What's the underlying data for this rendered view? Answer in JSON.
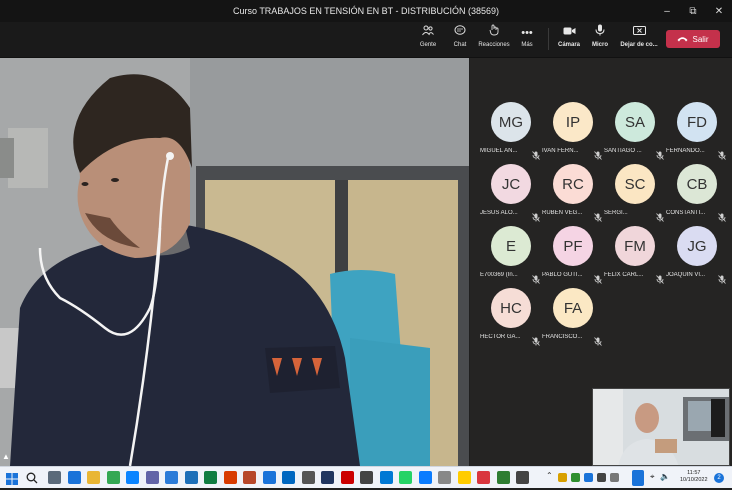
{
  "window": {
    "title": "Curso TRABAJOS EN TENSIÓN EN BT - DISTRIBUCIÓN (38569)",
    "minimize_icon": "minimize-icon",
    "restore_icon": "restore-icon",
    "close_icon": "close-icon"
  },
  "toolbar": {
    "people_label": "Gente",
    "chat_label": "Chat",
    "reactions_label": "Reacciones",
    "more_label": "Más",
    "camera_label": "Cámara",
    "mic_label": "Micro",
    "share_label": "Dejar de co...",
    "leave_label": "Salir",
    "leave_color": "#c4314b"
  },
  "participants": [
    {
      "initials": "MG",
      "name": "MIGUEL AN...",
      "color": "#dce4ea"
    },
    {
      "initials": "IP",
      "name": "IVAN FERN...",
      "color": "#fbe8c8"
    },
    {
      "initials": "SA",
      "name": "SANTIAGO ...",
      "color": "#cde9dc"
    },
    {
      "initials": "FD",
      "name": "FERNANDO...",
      "color": "#d2e3f2"
    },
    {
      "initials": "JC",
      "name": "JESUS ALO...",
      "color": "#f2d9e1"
    },
    {
      "initials": "RC",
      "name": "RUBEN VEG...",
      "color": "#fbdcd5"
    },
    {
      "initials": "SC",
      "name": "SERGI...",
      "color": "#fbe6c3"
    },
    {
      "initials": "CB",
      "name": "CONSTANTI...",
      "color": "#dce7d6"
    },
    {
      "initials": "E",
      "name": "E700369 (In...",
      "color": "#dcead3"
    },
    {
      "initials": "PF",
      "name": "PABLO GUTI...",
      "color": "#f5d4e4"
    },
    {
      "initials": "FM",
      "name": "FELIX CARL...",
      "color": "#f0d6da"
    },
    {
      "initials": "JG",
      "name": "JOAQUIN VI...",
      "color": "#dadcf2"
    },
    {
      "initials": "HC",
      "name": "HECTOR GA...",
      "color": "#f6ddd6"
    },
    {
      "initials": "FA",
      "name": "FRANCISCO...",
      "color": "#fbe8c4"
    }
  ],
  "taskbar": {
    "time": "11:57",
    "date": "10/10/2022",
    "notification_count": "2"
  }
}
